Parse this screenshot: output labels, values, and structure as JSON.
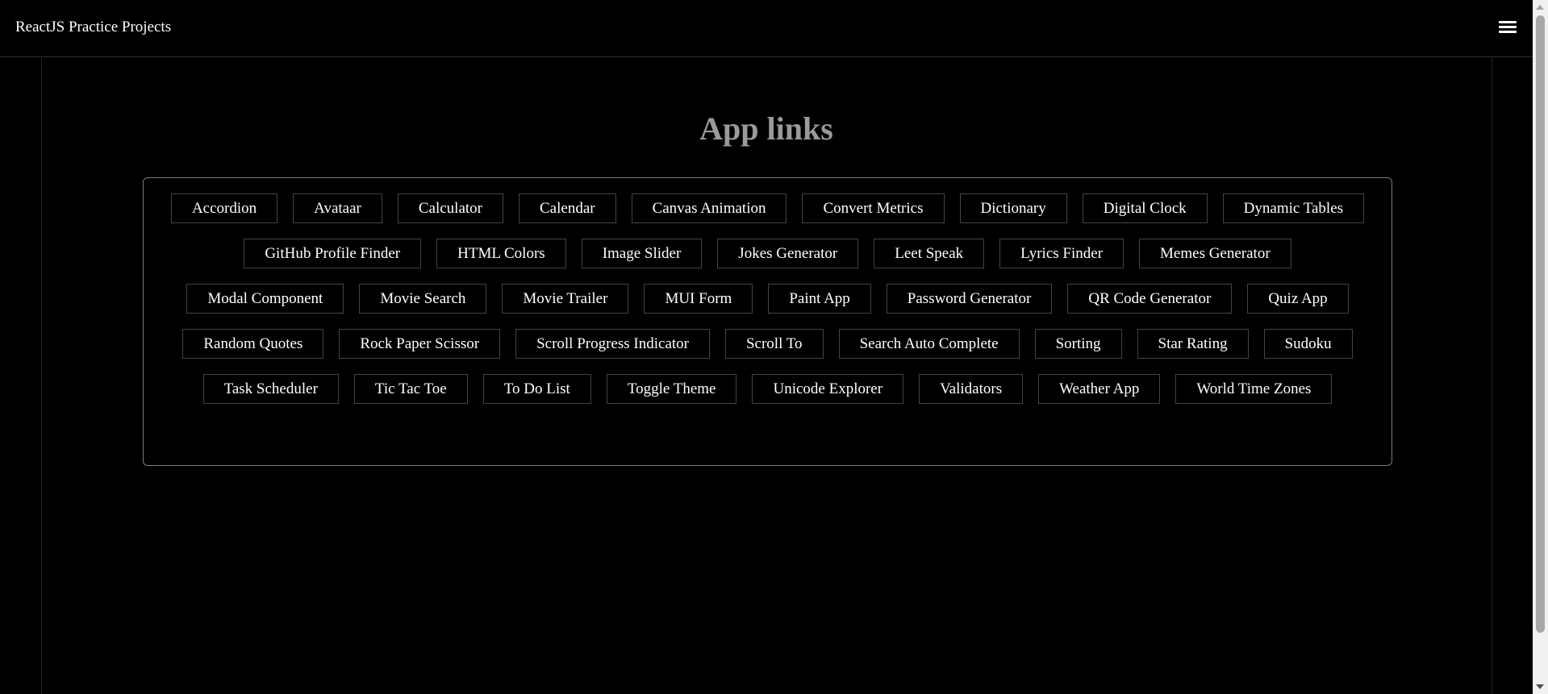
{
  "navbar": {
    "brand": "ReactJS Practice Projects",
    "menu_icon": "hamburger-menu-icon"
  },
  "main": {
    "title": "App links",
    "links": [
      "Accordion",
      "Avataar",
      "Calculator",
      "Calendar",
      "Canvas Animation",
      "Convert Metrics",
      "Dictionary",
      "Digital Clock",
      "Dynamic Tables",
      "GitHub Profile Finder",
      "HTML Colors",
      "Image Slider",
      "Jokes Generator",
      "Leet Speak",
      "Lyrics Finder",
      "Memes Generator",
      "Modal Component",
      "Movie Search",
      "Movie Trailer",
      "MUI Form",
      "Paint App",
      "Password Generator",
      "QR Code Generator",
      "Quiz App",
      "Random Quotes",
      "Rock Paper Scissor",
      "Scroll Progress Indicator",
      "Scroll To",
      "Search Auto Complete",
      "Sorting",
      "Star Rating",
      "Sudoku",
      "Task Scheduler",
      "Tic Tac Toe",
      "To Do List",
      "Toggle Theme",
      "Unicode Explorer",
      "Validators",
      "Weather App",
      "World Time Zones"
    ]
  },
  "colors": {
    "background": "#000000",
    "text": "#ffffff",
    "title": "#9a9a9a",
    "box_border": "#7a7a7a",
    "button_border": "#444444"
  }
}
